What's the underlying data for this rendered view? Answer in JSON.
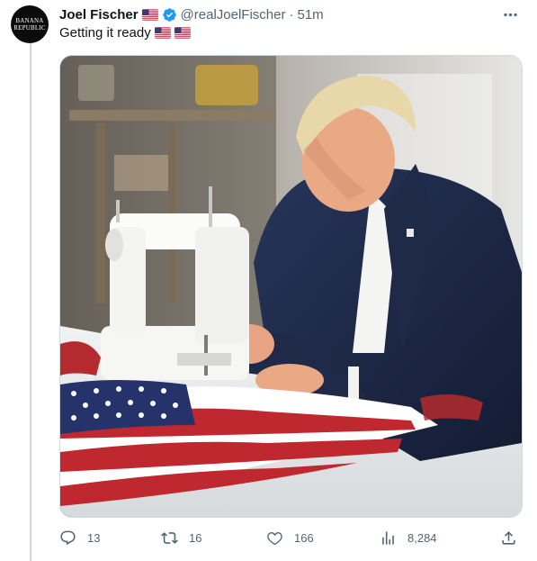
{
  "author": {
    "avatar_text_line1": "BANANA",
    "avatar_text_line2": "REPUBLIC",
    "name": "Joel Fischer",
    "handle": "@realJoelFischer",
    "separator": "·",
    "time": "51m",
    "verified": true
  },
  "tweet": {
    "text": "Getting it ready",
    "flags_in_text": 2
  },
  "media": {
    "description_alt": ""
  },
  "actions": {
    "replies": "13",
    "reposts": "16",
    "likes": "166",
    "views": "8,284"
  },
  "colors": {
    "text_primary": "#0f1419",
    "text_secondary": "#536471",
    "verified_blue": "#1d9bf0",
    "thread_line": "#cfd9de"
  },
  "icons": [
    "more-icon",
    "verified-badge-icon",
    "reply-icon",
    "repost-icon",
    "like-icon",
    "views-icon",
    "share-icon",
    "us-flag-icon"
  ]
}
